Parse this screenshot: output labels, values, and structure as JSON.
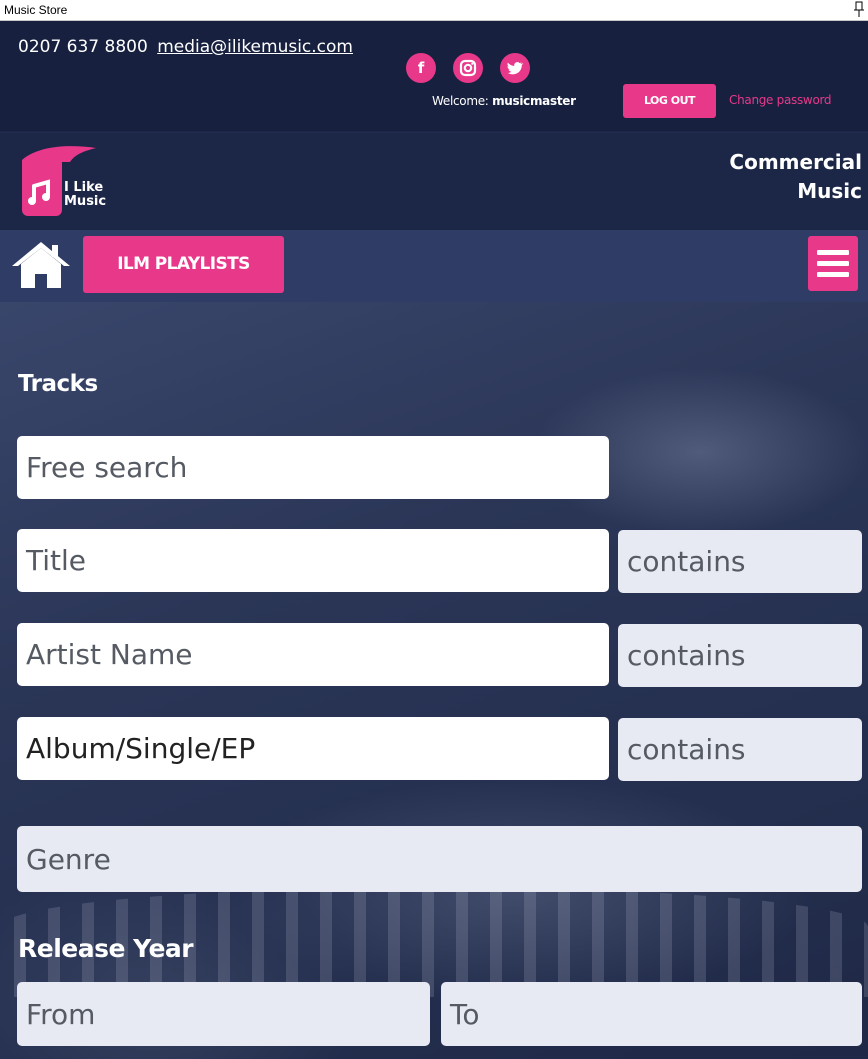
{
  "window": {
    "title": "Music Store"
  },
  "contact": {
    "phone": "0207 637 8800",
    "email": "media@ilikemusic.com"
  },
  "social": [
    {
      "icon": "facebook-icon",
      "glyph": "f"
    },
    {
      "icon": "instagram-icon",
      "glyph": "◎"
    },
    {
      "icon": "twitter-icon",
      "glyph": "✔"
    }
  ],
  "account": {
    "welcome_prefix": "Welcome:",
    "username": "musicmaster",
    "logout_label": "LOG OUT",
    "change_password_label": "Change password"
  },
  "brand": {
    "logo_line1": "I Like",
    "logo_line2": "Music",
    "tagline_line1": "Commercial",
    "tagline_line2": "Music"
  },
  "nav": {
    "home_icon": "home-icon",
    "playlists_label": "ILM PLAYLISTS",
    "menu_icon": "hamburger-menu-icon"
  },
  "search": {
    "section_title": "Tracks",
    "free_search_placeholder": "Free search",
    "title_placeholder": "Title",
    "title_match": "contains",
    "artist_placeholder": "Artist Name",
    "artist_match": "contains",
    "album_value": "Album/Single/EP",
    "album_match": "contains",
    "genre_placeholder": "Genre",
    "release_year_title": "Release Year",
    "year_from_placeholder": "From",
    "year_to_placeholder": "To"
  },
  "colors": {
    "accent": "#e8388a",
    "header_bg": "#17213f",
    "nav_bg": "#2e3c66"
  }
}
